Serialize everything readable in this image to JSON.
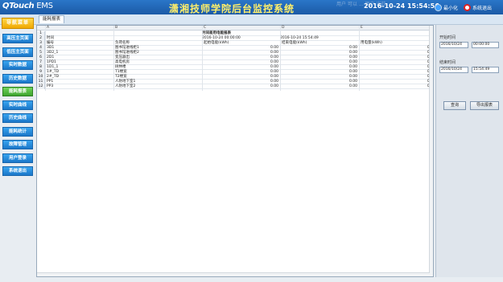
{
  "header": {
    "logo": "QTouch",
    "logo_suffix": "EMS",
    "title": "潇湘技师学院后台监控系统",
    "faint_text": "用户 可以 ... 用户 当前",
    "datetime": "2016-10-24  15:54:56",
    "minimize_label": "最小化",
    "exit_label": "系统退出"
  },
  "tab": {
    "label": "能耗报表"
  },
  "nav": {
    "title": "导航菜单",
    "items": [
      {
        "label": "高压主页面"
      },
      {
        "label": "低压主页面"
      },
      {
        "label": "实时数据"
      },
      {
        "label": "历史数据"
      },
      {
        "label": "能耗报表"
      },
      {
        "label": "实时曲线"
      },
      {
        "label": "历史曲线"
      },
      {
        "label": "能耗统计"
      },
      {
        "label": "故障管理"
      },
      {
        "label": "用户登录"
      },
      {
        "label": "系统退出"
      }
    ],
    "active_index": 4
  },
  "sheet": {
    "columns": [
      "A",
      "B",
      "C",
      "D",
      "E"
    ],
    "report_title": "时间差用电能报表",
    "time_label": "时间",
    "start_time": "2016-10-24 00:00:00",
    "end_time": "2016-10-24 15:54:49",
    "headers": [
      "编号",
      "负荷名称",
      "起始电能(kWh)",
      "结束电能(kWh)",
      "用电量(kWh)"
    ],
    "rows": [
      {
        "code": "3D1",
        "name": "图书馆进线柜1",
        "start": "0.00",
        "end": "0.00",
        "usage": "0.0"
      },
      {
        "code": "3D2_1",
        "name": "图书馆进线柜2",
        "start": "0.00",
        "end": "0.00",
        "usage": "0.0"
      },
      {
        "code": "2D1",
        "name": "变压器出",
        "start": "0.00",
        "end": "0.00",
        "usage": "0.0"
      },
      {
        "code": "1PD1",
        "name": "高电机房",
        "start": "0.00",
        "end": "0.00",
        "usage": "0.0"
      },
      {
        "code": "1D1_1",
        "name": "树林楼",
        "start": "0.00",
        "end": "0.00",
        "usage": "0.0"
      },
      {
        "code": "1#_TD",
        "name": "T1楼宽",
        "start": "0.00",
        "end": "0.00",
        "usage": "0.0"
      },
      {
        "code": "2#_TD",
        "name": "T2楼宽",
        "start": "0.00",
        "end": "0.00",
        "usage": "0.0"
      },
      {
        "code": "PP1",
        "name": "人防地下室1",
        "start": "0.00",
        "end": "0.00",
        "usage": "0.0"
      },
      {
        "code": "PP3",
        "name": "人防地下室2",
        "start": "0.00",
        "end": "0.00",
        "usage": "0.0"
      }
    ]
  },
  "panel": {
    "start_label": "开始时间",
    "start_date": "2016/10/24",
    "start_time": "00:00:00",
    "end_label": "结束时间",
    "end_date": "2016/10/24",
    "end_time": "15:54:49",
    "query_label": "查询",
    "export_label": "导出报表"
  },
  "colors": {
    "header_bg": "#1b5aa6",
    "title": "#ffef6a",
    "nav_blue": "#1b77c9",
    "nav_active": "#3ea52f",
    "nav_title": "#f0a800"
  }
}
